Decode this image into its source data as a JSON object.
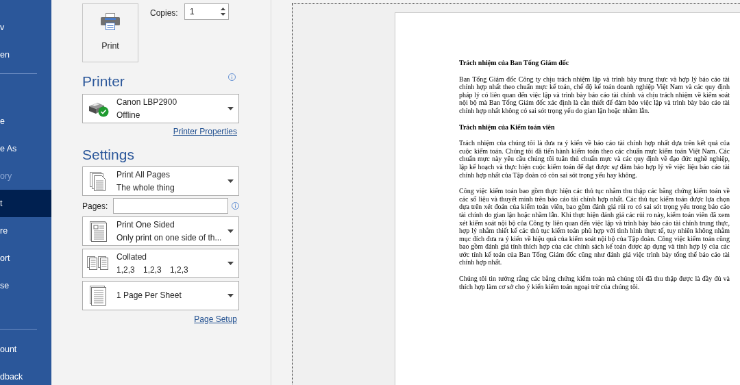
{
  "sidebar": {
    "sections": [
      {
        "items": [
          {
            "label": "v",
            "selected": false,
            "disabled": false
          },
          {
            "label": "en",
            "selected": false,
            "disabled": false
          }
        ]
      },
      {
        "items": [
          {
            "label": "e",
            "selected": false,
            "disabled": false
          },
          {
            "label": "e As",
            "selected": false,
            "disabled": false
          },
          {
            "label": "ory",
            "selected": false,
            "disabled": true
          },
          {
            "label": "t",
            "selected": true,
            "disabled": false
          },
          {
            "label": "re",
            "selected": false,
            "disabled": false
          },
          {
            "label": "ort",
            "selected": false,
            "disabled": false
          },
          {
            "label": "se",
            "selected": false,
            "disabled": false
          }
        ]
      },
      {
        "items": [
          {
            "label": "ount",
            "selected": false,
            "disabled": false
          },
          {
            "label": "dback",
            "selected": false,
            "disabled": false
          }
        ]
      }
    ]
  },
  "print": {
    "button": "Print",
    "copies_label": "Copies:",
    "copies": "1"
  },
  "printer": {
    "heading": "Printer",
    "name": "Canon LBP2900",
    "status": "Offline",
    "properties_link": "Printer Properties"
  },
  "settings": {
    "heading": "Settings",
    "options": [
      {
        "kind": "pages",
        "title": "Print All Pages",
        "subtitle": "The whole thing"
      },
      {
        "kind": "sides",
        "title": "Print One Sided",
        "subtitle": "Only print on one side of th..."
      },
      {
        "kind": "collation",
        "title": "Collated",
        "subtitle": "1,2,3 1,2,3 1,2,3"
      },
      {
        "kind": "layout",
        "title": "1 Page Per Sheet"
      }
    ],
    "pages_label": "Pages:",
    "page_setup_link": "Page Setup"
  },
  "preview": {
    "paragraphs": [
      {
        "kind": "heading",
        "text": "Trách nhiệm của Ban Tổng Giám đốc"
      },
      {
        "kind": "body",
        "text": "Ban Tổng Giám đốc Công ty chịu trách nhiệm lập và trình bày trung thực và hợp lý báo cáo tài chính hợp nhất theo chuẩn mực kế toán, chế độ kế toán doanh nghiệp Việt Nam và các quy định pháp lý có liên quan đến việc lập và trình bày báo cáo tài chính và chịu trách nhiệm về kiểm soát nội bộ mà Ban Tổng Giám đốc xác định là cần thiết để đảm bảo việc lập và trình bày báo cáo tài chính hợp nhất không có sai sót trọng yếu do gian lận hoặc nhầm lẫn."
      },
      {
        "kind": "heading",
        "text": "Trách nhiệm của Kiểm toán viên"
      },
      {
        "kind": "body",
        "text": "Trách nhiệm của chúng tôi là đưa ra ý kiến về báo cáo tài chính hợp nhất dựa trên kết quả của cuộc kiểm toán. Chúng tôi đã tiến hành kiểm toán theo các chuẩn mực kiểm toán Việt Nam. Các chuẩn mực này yêu cầu chúng tôi tuân thủ chuẩn mực và các quy định về đạo đức nghề nghiệp, lập kế hoạch và thực hiện cuộc kiểm toán để đạt được sự đảm bảo hợp lý về việc liệu báo cáo tài chính hợp nhất của Tập đoàn có còn sai sót trọng yếu hay không."
      },
      {
        "kind": "body",
        "text": "Công việc kiểm toán bao gồm thực hiện các thủ tục nhằm thu thập các bằng chứng kiểm toán về các số liệu và thuyết minh trên báo cáo tài chính hợp nhất. Các thủ tục kiểm toán được lựa chọn dựa trên xét đoán của kiểm toán viên, bao gồm đánh giá rủi ro có sai sót trọng yếu trong báo cáo tài chính do gian lận hoặc nhầm lẫn. Khi thực hiện đánh giá các rủi ro này, kiểm toán viên đã xem xét kiểm soát nội bộ của Công ty liên quan đến việc lập và trình bày báo cáo tài chính trung thực, hợp lý nhằm thiết kế các thủ tục kiểm toán phù hợp với tình hình thực tế, tuy nhiên không nhằm mục đích đưa ra ý kiến về hiệu quả của kiểm soát nội bộ của Tập đoàn. Công việc kiểm toán cũng bao gồm đánh giá tính thích hợp của các chính sách kế toán được áp dụng và tính hợp lý của các ước tính kế toán của Ban Tổng Giám đốc cũng như đánh giá việc trình bày tổng thể báo cáo tài chính hợp nhất."
      },
      {
        "kind": "body",
        "text": "Chúng tôi tin tưởng rằng các bằng chứng kiểm toán mà chúng tôi đã thu thập được là đầy đủ và thích hợp làm cơ sở cho ý kiến kiểm toán ngoại trừ của chúng tôi."
      }
    ]
  }
}
